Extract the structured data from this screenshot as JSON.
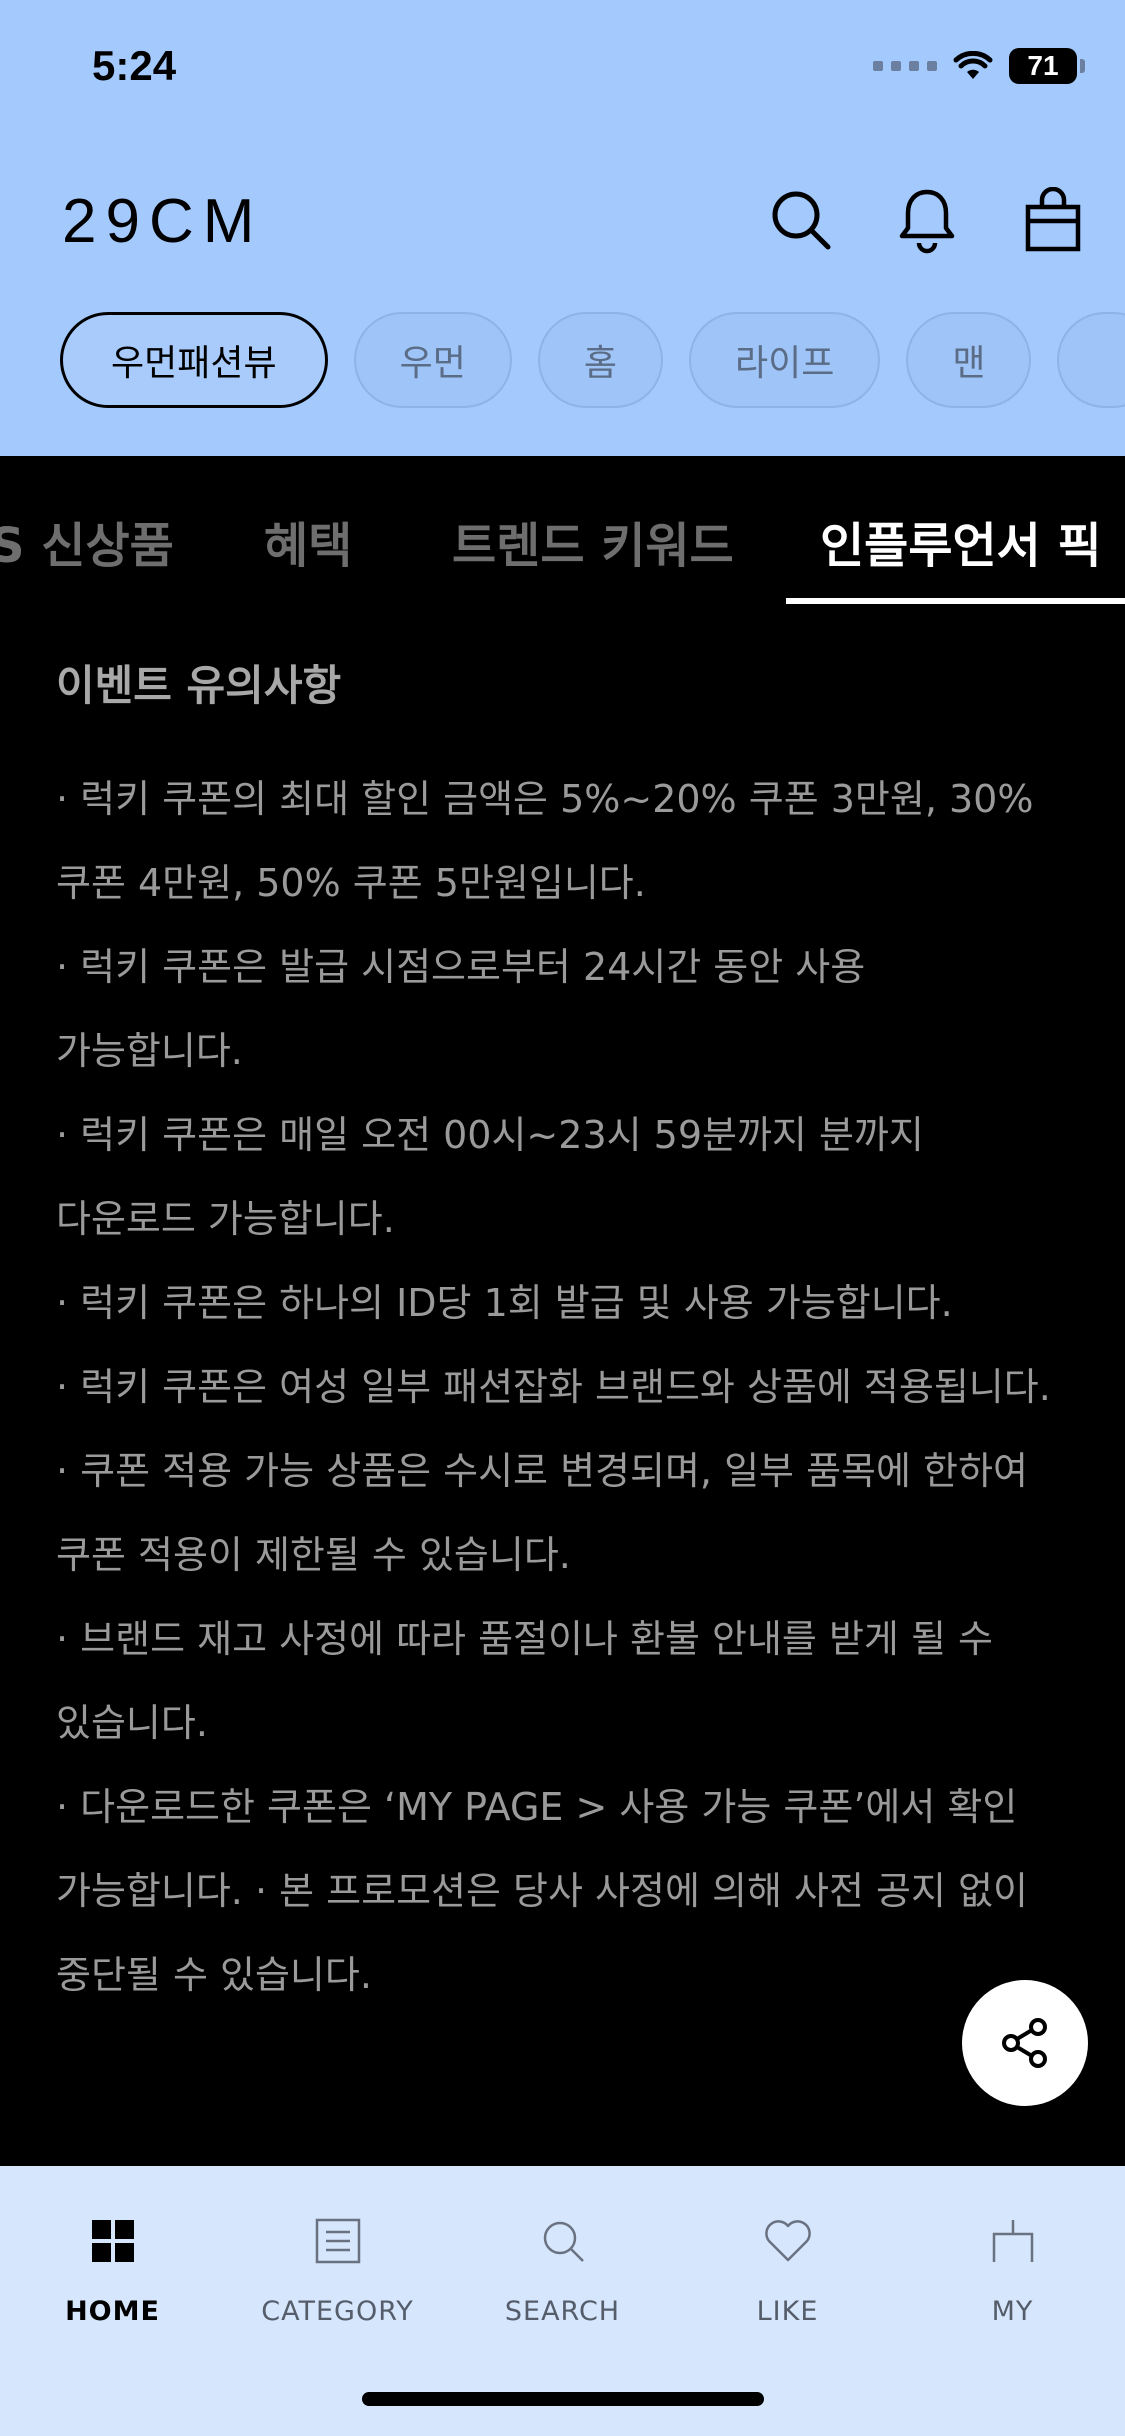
{
  "status_bar": {
    "time": "5:24",
    "battery": "71"
  },
  "header": {
    "logo": "29CM"
  },
  "chips": [
    "우먼패션뷰",
    "우먼",
    "홈",
    "라이프",
    "맨"
  ],
  "active_chip_index": 0,
  "subtabs": [
    "S 신상품",
    "혜택",
    "트렌드 키워드",
    "인플루언서 픽"
  ],
  "active_subtab_index": 3,
  "notice": {
    "title": "이벤트 유의사항",
    "lines": [
      "· 럭키 쿠폰의 최대 할인 금액은 5%~20% 쿠폰 3만원, 30%",
      "쿠폰 4만원, 50% 쿠폰 5만원입니다.",
      "· 럭키 쿠폰은 발급 시점으로부터 24시간 동안 사용",
      "가능합니다.",
      "· 럭키 쿠폰은 매일 오전 00시~23시 59분까지 분까지",
      "다운로드 가능합니다.",
      "· 럭키 쿠폰은 하나의 ID당 1회 발급 및 사용 가능합니다.",
      "· 럭키 쿠폰은 여성 일부 패션잡화 브랜드와 상품에 적용됩니다.",
      "· 쿠폰 적용 가능 상품은 수시로 변경되며, 일부 품목에 한하여",
      "쿠폰 적용이 제한될 수 있습니다.",
      "· 브랜드 재고 사정에 따라 품절이나 환불 안내를 받게 될 수",
      "있습니다.",
      "· 다운로드한 쿠폰은 ‘MY PAGE > 사용 가능 쿠폰’에서 확인",
      "가능합니다. · 본 프로모션은 당사 사정에 의해 사전 공지 없이",
      "중단될 수 있습니다."
    ]
  },
  "bottom_nav": {
    "items": [
      {
        "label": "HOME",
        "icon": "home-grid-icon"
      },
      {
        "label": "CATEGORY",
        "icon": "category-list-icon"
      },
      {
        "label": "SEARCH",
        "icon": "search-icon"
      },
      {
        "label": "LIKE",
        "icon": "heart-icon"
      },
      {
        "label": "MY",
        "icon": "my-page-icon"
      }
    ],
    "active_index": 0
  }
}
